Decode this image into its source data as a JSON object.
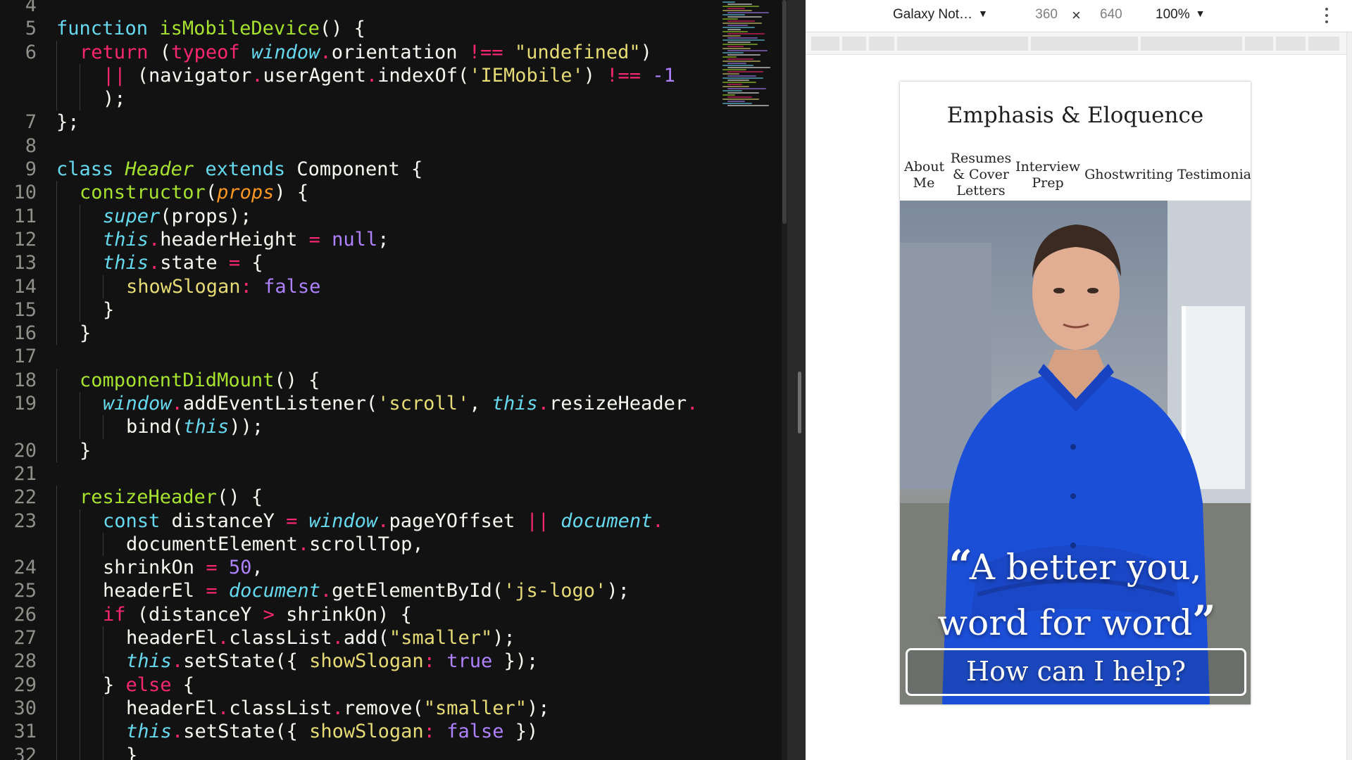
{
  "editor": {
    "lines": [
      {
        "n": "4",
        "indent": 0,
        "tokens": []
      },
      {
        "n": "5",
        "indent": 0,
        "tokens": [
          [
            "st",
            "function"
          ],
          [
            "pl",
            " "
          ],
          [
            "fn",
            "isMobileDevice"
          ],
          [
            "pl",
            "() {"
          ]
        ]
      },
      {
        "n": "6",
        "indent": 1,
        "tokens": [
          [
            "kw",
            "return"
          ],
          [
            "pl",
            " ("
          ],
          [
            "kw",
            "typeof"
          ],
          [
            "pl",
            " "
          ],
          [
            "it",
            "window"
          ],
          [
            "op",
            "."
          ],
          [
            "pl",
            "orientation "
          ],
          [
            "op",
            "!=="
          ],
          [
            "pl",
            " "
          ],
          [
            "str",
            "\"undefined\""
          ],
          [
            "pl",
            ")"
          ]
        ]
      },
      {
        "n": "",
        "indent": 2,
        "tokens": [
          [
            "op",
            "||"
          ],
          [
            "pl",
            " (navigator"
          ],
          [
            "op",
            "."
          ],
          [
            "pl",
            "userAgent"
          ],
          [
            "op",
            "."
          ],
          [
            "pl",
            "indexOf("
          ],
          [
            "str",
            "'IEMobile'"
          ],
          [
            "pl",
            ") "
          ],
          [
            "op",
            "!=="
          ],
          [
            "pl",
            " "
          ],
          [
            "num",
            "-1"
          ]
        ]
      },
      {
        "n": "",
        "indent": 2,
        "tokens": [
          [
            "pl",
            ");"
          ]
        ]
      },
      {
        "n": "7",
        "indent": 0,
        "tokens": [
          [
            "pl",
            "};"
          ]
        ]
      },
      {
        "n": "8",
        "indent": 0,
        "tokens": []
      },
      {
        "n": "9",
        "indent": 0,
        "tokens": [
          [
            "st",
            "class"
          ],
          [
            "pl",
            " "
          ],
          [
            "cls",
            "Header"
          ],
          [
            "pl",
            " "
          ],
          [
            "st",
            "extends"
          ],
          [
            "pl",
            " Component {"
          ]
        ]
      },
      {
        "n": "10",
        "indent": 1,
        "tokens": [
          [
            "fn",
            "constructor"
          ],
          [
            "pl",
            "("
          ],
          [
            "par",
            "props"
          ],
          [
            "pl",
            ") {"
          ]
        ]
      },
      {
        "n": "11",
        "indent": 2,
        "tokens": [
          [
            "it",
            "super"
          ],
          [
            "pl",
            "(props);"
          ]
        ]
      },
      {
        "n": "12",
        "indent": 2,
        "tokens": [
          [
            "it",
            "this"
          ],
          [
            "op",
            "."
          ],
          [
            "pl",
            "headerHeight "
          ],
          [
            "op",
            "="
          ],
          [
            "pl",
            " "
          ],
          [
            "num",
            "null"
          ],
          [
            "pl",
            ";"
          ]
        ]
      },
      {
        "n": "13",
        "indent": 2,
        "tokens": [
          [
            "it",
            "this"
          ],
          [
            "op",
            "."
          ],
          [
            "pl",
            "state "
          ],
          [
            "op",
            "="
          ],
          [
            "pl",
            " {"
          ]
        ]
      },
      {
        "n": "14",
        "indent": 3,
        "tokens": [
          [
            "str",
            "showSlogan"
          ],
          [
            "op",
            ":"
          ],
          [
            "pl",
            " "
          ],
          [
            "num",
            "false"
          ]
        ]
      },
      {
        "n": "15",
        "indent": 2,
        "tokens": [
          [
            "pl",
            "}"
          ]
        ]
      },
      {
        "n": "16",
        "indent": 1,
        "tokens": [
          [
            "pl",
            "}"
          ]
        ]
      },
      {
        "n": "17",
        "indent": 0,
        "tokens": []
      },
      {
        "n": "18",
        "indent": 1,
        "tokens": [
          [
            "fn",
            "componentDidMount"
          ],
          [
            "pl",
            "() {"
          ]
        ]
      },
      {
        "n": "19",
        "indent": 2,
        "tokens": [
          [
            "it",
            "window"
          ],
          [
            "op",
            "."
          ],
          [
            "pl",
            "addEventListener("
          ],
          [
            "str",
            "'scroll'"
          ],
          [
            "pl",
            ", "
          ],
          [
            "it",
            "this"
          ],
          [
            "op",
            "."
          ],
          [
            "pl",
            "resizeHeader"
          ],
          [
            "op",
            "."
          ]
        ]
      },
      {
        "n": "",
        "indent": 3,
        "tokens": [
          [
            "pl",
            "bind("
          ],
          [
            "it",
            "this"
          ],
          [
            "pl",
            "));"
          ]
        ]
      },
      {
        "n": "20",
        "indent": 1,
        "tokens": [
          [
            "pl",
            "}"
          ]
        ]
      },
      {
        "n": "21",
        "indent": 0,
        "tokens": []
      },
      {
        "n": "22",
        "indent": 1,
        "tokens": [
          [
            "fn",
            "resizeHeader"
          ],
          [
            "pl",
            "() {"
          ]
        ]
      },
      {
        "n": "23",
        "indent": 2,
        "tokens": [
          [
            "st",
            "const"
          ],
          [
            "pl",
            " distanceY "
          ],
          [
            "op",
            "="
          ],
          [
            "pl",
            " "
          ],
          [
            "it",
            "window"
          ],
          [
            "op",
            "."
          ],
          [
            "pl",
            "pageYOffset "
          ],
          [
            "op",
            "||"
          ],
          [
            "pl",
            " "
          ],
          [
            "it",
            "document"
          ],
          [
            "op",
            "."
          ]
        ]
      },
      {
        "n": "",
        "indent": 3,
        "tokens": [
          [
            "pl",
            "documentElement"
          ],
          [
            "op",
            "."
          ],
          [
            "pl",
            "scrollTop,"
          ]
        ]
      },
      {
        "n": "24",
        "indent": 2,
        "tokens": [
          [
            "pl",
            "shrinkOn "
          ],
          [
            "op",
            "="
          ],
          [
            "pl",
            " "
          ],
          [
            "num",
            "50"
          ],
          [
            "pl",
            ","
          ]
        ]
      },
      {
        "n": "25",
        "indent": 2,
        "tokens": [
          [
            "pl",
            "headerEl "
          ],
          [
            "op",
            "="
          ],
          [
            "pl",
            " "
          ],
          [
            "it",
            "document"
          ],
          [
            "op",
            "."
          ],
          [
            "pl",
            "getElementById("
          ],
          [
            "str",
            "'js-logo'"
          ],
          [
            "pl",
            ");"
          ]
        ]
      },
      {
        "n": "26",
        "indent": 2,
        "tokens": [
          [
            "kw",
            "if"
          ],
          [
            "pl",
            " (distanceY "
          ],
          [
            "op",
            ">"
          ],
          [
            "pl",
            " shrinkOn) {"
          ]
        ]
      },
      {
        "n": "27",
        "indent": 3,
        "tokens": [
          [
            "pl",
            "headerEl"
          ],
          [
            "op",
            "."
          ],
          [
            "pl",
            "classList"
          ],
          [
            "op",
            "."
          ],
          [
            "pl",
            "add("
          ],
          [
            "str",
            "\"smaller\""
          ],
          [
            "pl",
            ");"
          ]
        ]
      },
      {
        "n": "28",
        "indent": 3,
        "tokens": [
          [
            "it",
            "this"
          ],
          [
            "op",
            "."
          ],
          [
            "pl",
            "setState({ "
          ],
          [
            "str",
            "showSlogan"
          ],
          [
            "op",
            ":"
          ],
          [
            "pl",
            " "
          ],
          [
            "num",
            "true"
          ],
          [
            "pl",
            " });"
          ]
        ]
      },
      {
        "n": "29",
        "indent": 2,
        "tokens": [
          [
            "pl",
            "} "
          ],
          [
            "kw",
            "else"
          ],
          [
            "pl",
            " {"
          ]
        ]
      },
      {
        "n": "30",
        "indent": 3,
        "tokens": [
          [
            "pl",
            "headerEl"
          ],
          [
            "op",
            "."
          ],
          [
            "pl",
            "classList"
          ],
          [
            "op",
            "."
          ],
          [
            "pl",
            "remove("
          ],
          [
            "str",
            "\"smaller\""
          ],
          [
            "pl",
            ");"
          ]
        ]
      },
      {
        "n": "31",
        "indent": 3,
        "tokens": [
          [
            "it",
            "this"
          ],
          [
            "op",
            "."
          ],
          [
            "pl",
            "setState({ "
          ],
          [
            "str",
            "showSlogan"
          ],
          [
            "op",
            ":"
          ],
          [
            "pl",
            " "
          ],
          [
            "num",
            "false"
          ],
          [
            "pl",
            " })"
          ]
        ]
      },
      {
        "n": "32",
        "indent": 3,
        "tokens": [
          [
            "pl",
            "}"
          ]
        ]
      }
    ]
  },
  "devtools": {
    "device": "Galaxy Not…",
    "width": "360",
    "times": "×",
    "height": "640",
    "zoom": "100%",
    "caret": "▼"
  },
  "site": {
    "title": "Emphasis & Eloquence",
    "nav": [
      "About\nMe",
      "Resumes\n& Cover\nLetters",
      "Interview\nPrep",
      "Ghostwriting",
      "Testimonial"
    ],
    "quote_open": "“",
    "quote_line1": "A better you,",
    "quote_line2": "word for word",
    "quote_close": "”",
    "cta": "How can I help?"
  },
  "colors": {
    "editor_bg": "#121212",
    "shirt_blue": "#1c4fd8",
    "accent_pink": "#f92672"
  }
}
